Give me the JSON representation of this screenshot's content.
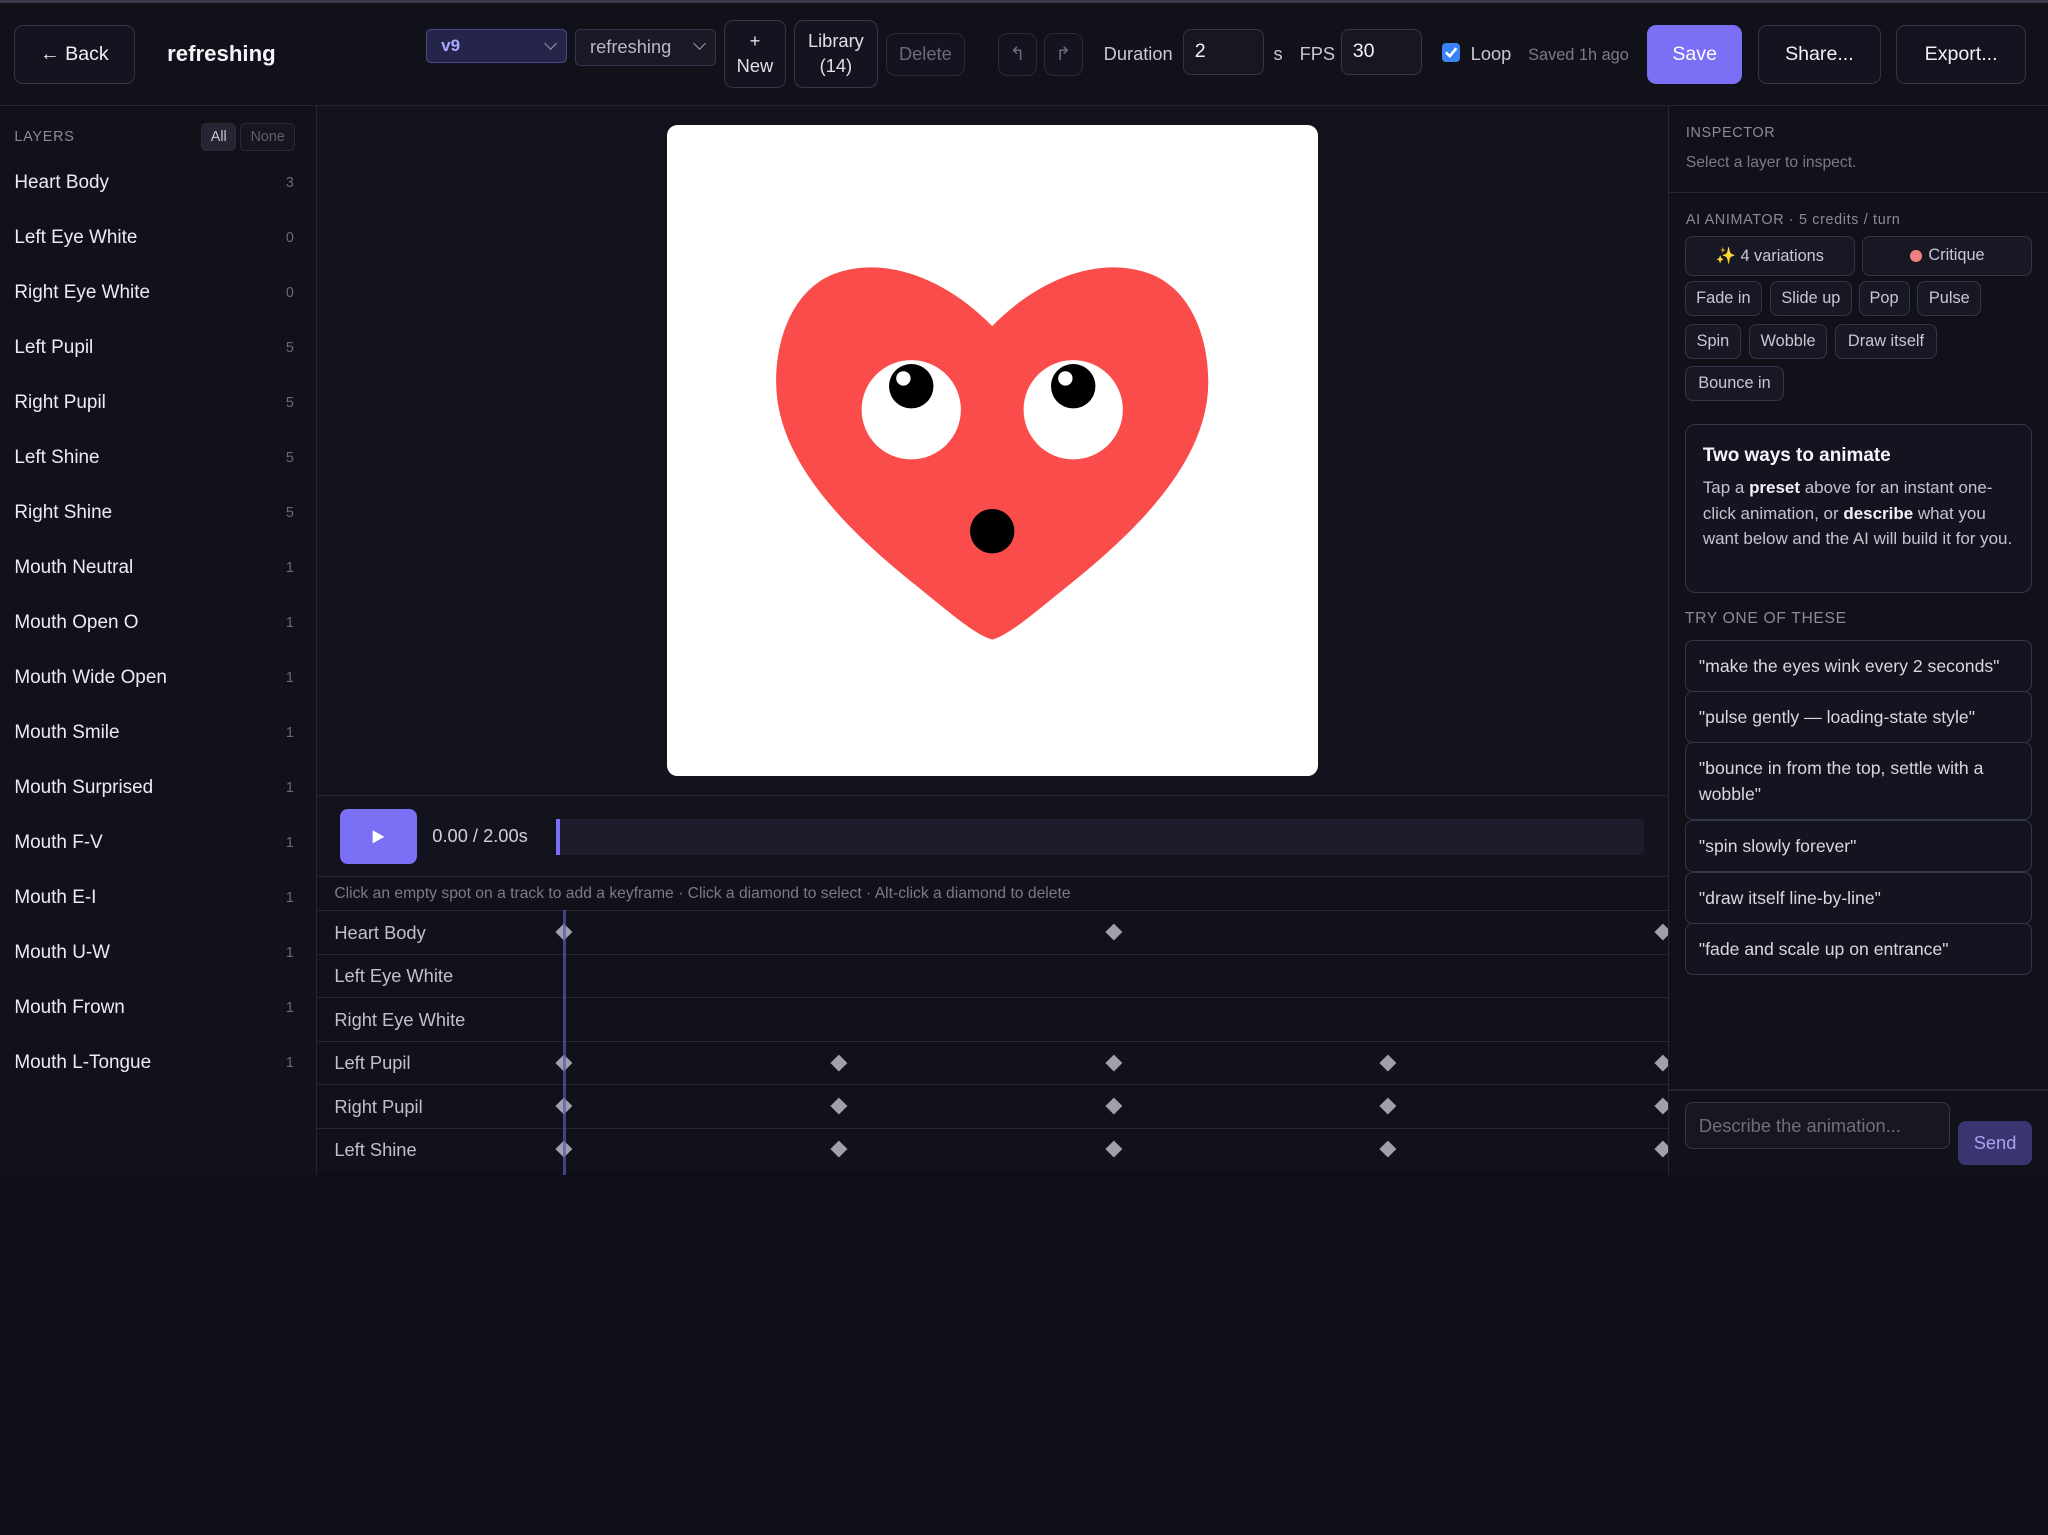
{
  "topbar": {
    "back_label": "← Back",
    "project_name": "refreshing",
    "version_select": "v9",
    "name_select": "refreshing",
    "new_icon": "+",
    "new_label": "New",
    "library_label": "Library",
    "library_count": "(14)",
    "delete_label": "Delete",
    "undo_icon": "↰",
    "redo_icon": "↱",
    "duration_label": "Duration",
    "duration_value": "2",
    "duration_unit": "s",
    "fps_label": "FPS",
    "fps_value": "30",
    "loop_label": "Loop",
    "loop_checked": true,
    "saved_status": "Saved 1h ago",
    "save_label": "Save",
    "share_label": "Share...",
    "export_label": "Export..."
  },
  "layers": {
    "title": "LAYERS",
    "all_label": "All",
    "none_label": "None",
    "items": [
      {
        "name": "Heart Body",
        "count": "3"
      },
      {
        "name": "Left Eye White",
        "count": "0"
      },
      {
        "name": "Right Eye White",
        "count": "0"
      },
      {
        "name": "Left Pupil",
        "count": "5"
      },
      {
        "name": "Right Pupil",
        "count": "5"
      },
      {
        "name": "Left Shine",
        "count": "5"
      },
      {
        "name": "Right Shine",
        "count": "5"
      },
      {
        "name": "Mouth Neutral",
        "count": "1"
      },
      {
        "name": "Mouth Open O",
        "count": "1"
      },
      {
        "name": "Mouth Wide Open",
        "count": "1"
      },
      {
        "name": "Mouth Smile",
        "count": "1"
      },
      {
        "name": "Mouth Surprised",
        "count": "1"
      },
      {
        "name": "Mouth F-V",
        "count": "1"
      },
      {
        "name": "Mouth E-I",
        "count": "1"
      },
      {
        "name": "Mouth U-W",
        "count": "1"
      },
      {
        "name": "Mouth Frown",
        "count": "1"
      },
      {
        "name": "Mouth L-Tongue",
        "count": "1"
      }
    ]
  },
  "canvas": {
    "heart_color": "#fb4c4c"
  },
  "timeline": {
    "play_icon": "play-icon",
    "time_display": "0.00 / 2.00s",
    "hint": "Click an empty spot on a track to add a keyframe · Click a diamond to select · Alt-click a diamond to delete",
    "tracks": [
      {
        "name": "Heart Body",
        "keyframes": [
          0,
          1,
          2
        ]
      },
      {
        "name": "Left Eye White",
        "keyframes": []
      },
      {
        "name": "Right Eye White",
        "keyframes": []
      },
      {
        "name": "Left Pupil",
        "keyframes": [
          0,
          0.5,
          1,
          1.5,
          2
        ]
      },
      {
        "name": "Right Pupil",
        "keyframes": [
          0,
          0.5,
          1,
          1.5,
          2
        ]
      },
      {
        "name": "Left Shine",
        "keyframes": [
          0,
          0.5,
          1,
          1.5,
          2
        ]
      }
    ]
  },
  "inspector": {
    "title": "INSPECTOR",
    "empty_text": "Select a layer to inspect.",
    "ai_title": "AI ANIMATOR · 5 credits / turn",
    "variations_label": "✨ 4 variations",
    "critique_label": "Critique",
    "presets": [
      "Fade in",
      "Slide up",
      "Pop",
      "Pulse",
      "Spin",
      "Wobble",
      "Draw itself",
      "Bounce in"
    ],
    "card_title": "Two ways to animate",
    "card_text_1": "Tap a ",
    "card_bold_1": "preset",
    "card_text_2": " above for an instant one-click animation, or ",
    "card_bold_2": "describe",
    "card_text_3": " what you want below and the AI will build it for you.",
    "try_title": "TRY ONE OF THESE",
    "suggestions": [
      "\"make the eyes wink every 2 seconds\"",
      "\"pulse gently — loading-state style\"",
      "\"bounce in from the top, settle with a wobble\"",
      "\"spin slowly forever\"",
      "\"draw itself line-by-line\"",
      "\"fade and scale up on entrance\""
    ],
    "input_placeholder": "Describe the animation...",
    "send_label": "Send"
  }
}
